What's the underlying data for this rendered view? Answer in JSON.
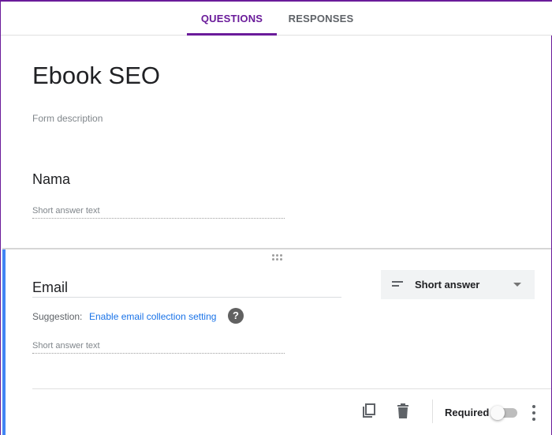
{
  "tabs": {
    "questions": "QUESTIONS",
    "responses": "RESPONSES"
  },
  "form": {
    "title": "Ebook SEO",
    "description_placeholder": "Form description"
  },
  "questions": [
    {
      "title": "Nama",
      "answer_placeholder": "Short answer text"
    },
    {
      "title": "Email",
      "type": "Short answer",
      "suggestion_label": "Suggestion:",
      "suggestion_link": "Enable email collection setting",
      "help_icon": "?",
      "answer_placeholder": "Short answer text",
      "required_label": "Required",
      "required": false
    }
  ],
  "icons": {
    "type": "short-text-icon",
    "duplicate": "copy-icon",
    "delete": "trash-icon",
    "more": "more-vert-icon",
    "drag": "drag-handle-icon"
  },
  "colors": {
    "accent": "#6a1b9a",
    "active_question": "#4285f4",
    "link": "#1a73e8"
  }
}
